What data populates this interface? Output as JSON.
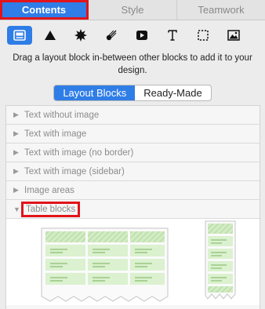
{
  "tabs": [
    {
      "label": "Contents",
      "active": true
    },
    {
      "label": "Style",
      "active": false
    },
    {
      "label": "Teamwork",
      "active": false
    }
  ],
  "toolbar": {
    "tools": [
      {
        "icon": "layout-block-icon",
        "active": true
      },
      {
        "icon": "shape-triangle-icon",
        "active": false
      },
      {
        "icon": "starburst-icon",
        "active": false
      },
      {
        "icon": "comet-icon",
        "active": false
      },
      {
        "icon": "video-play-icon",
        "active": false
      },
      {
        "icon": "text-t-icon",
        "active": false
      },
      {
        "icon": "selection-box-icon",
        "active": false
      },
      {
        "icon": "image-icon",
        "active": false
      }
    ]
  },
  "hint": "Drag a layout block in-between other blocks to add it to your design.",
  "segments": [
    {
      "label": "Layout Blocks",
      "active": true
    },
    {
      "label": "Ready-Made",
      "active": false
    }
  ],
  "categories": [
    {
      "label": "Text without image",
      "expanded": false
    },
    {
      "label": "Text with image",
      "expanded": false
    },
    {
      "label": "Text with image (no border)",
      "expanded": false
    },
    {
      "label": "Text with image (sidebar)",
      "expanded": false
    },
    {
      "label": "Image areas",
      "expanded": false
    },
    {
      "label": "Table blocks",
      "expanded": true
    }
  ],
  "colors": {
    "accent": "#2f7de6",
    "highlight": "#e0141a",
    "table_green": "#d9f0cc",
    "table_header_green": "#c7e6b6"
  }
}
